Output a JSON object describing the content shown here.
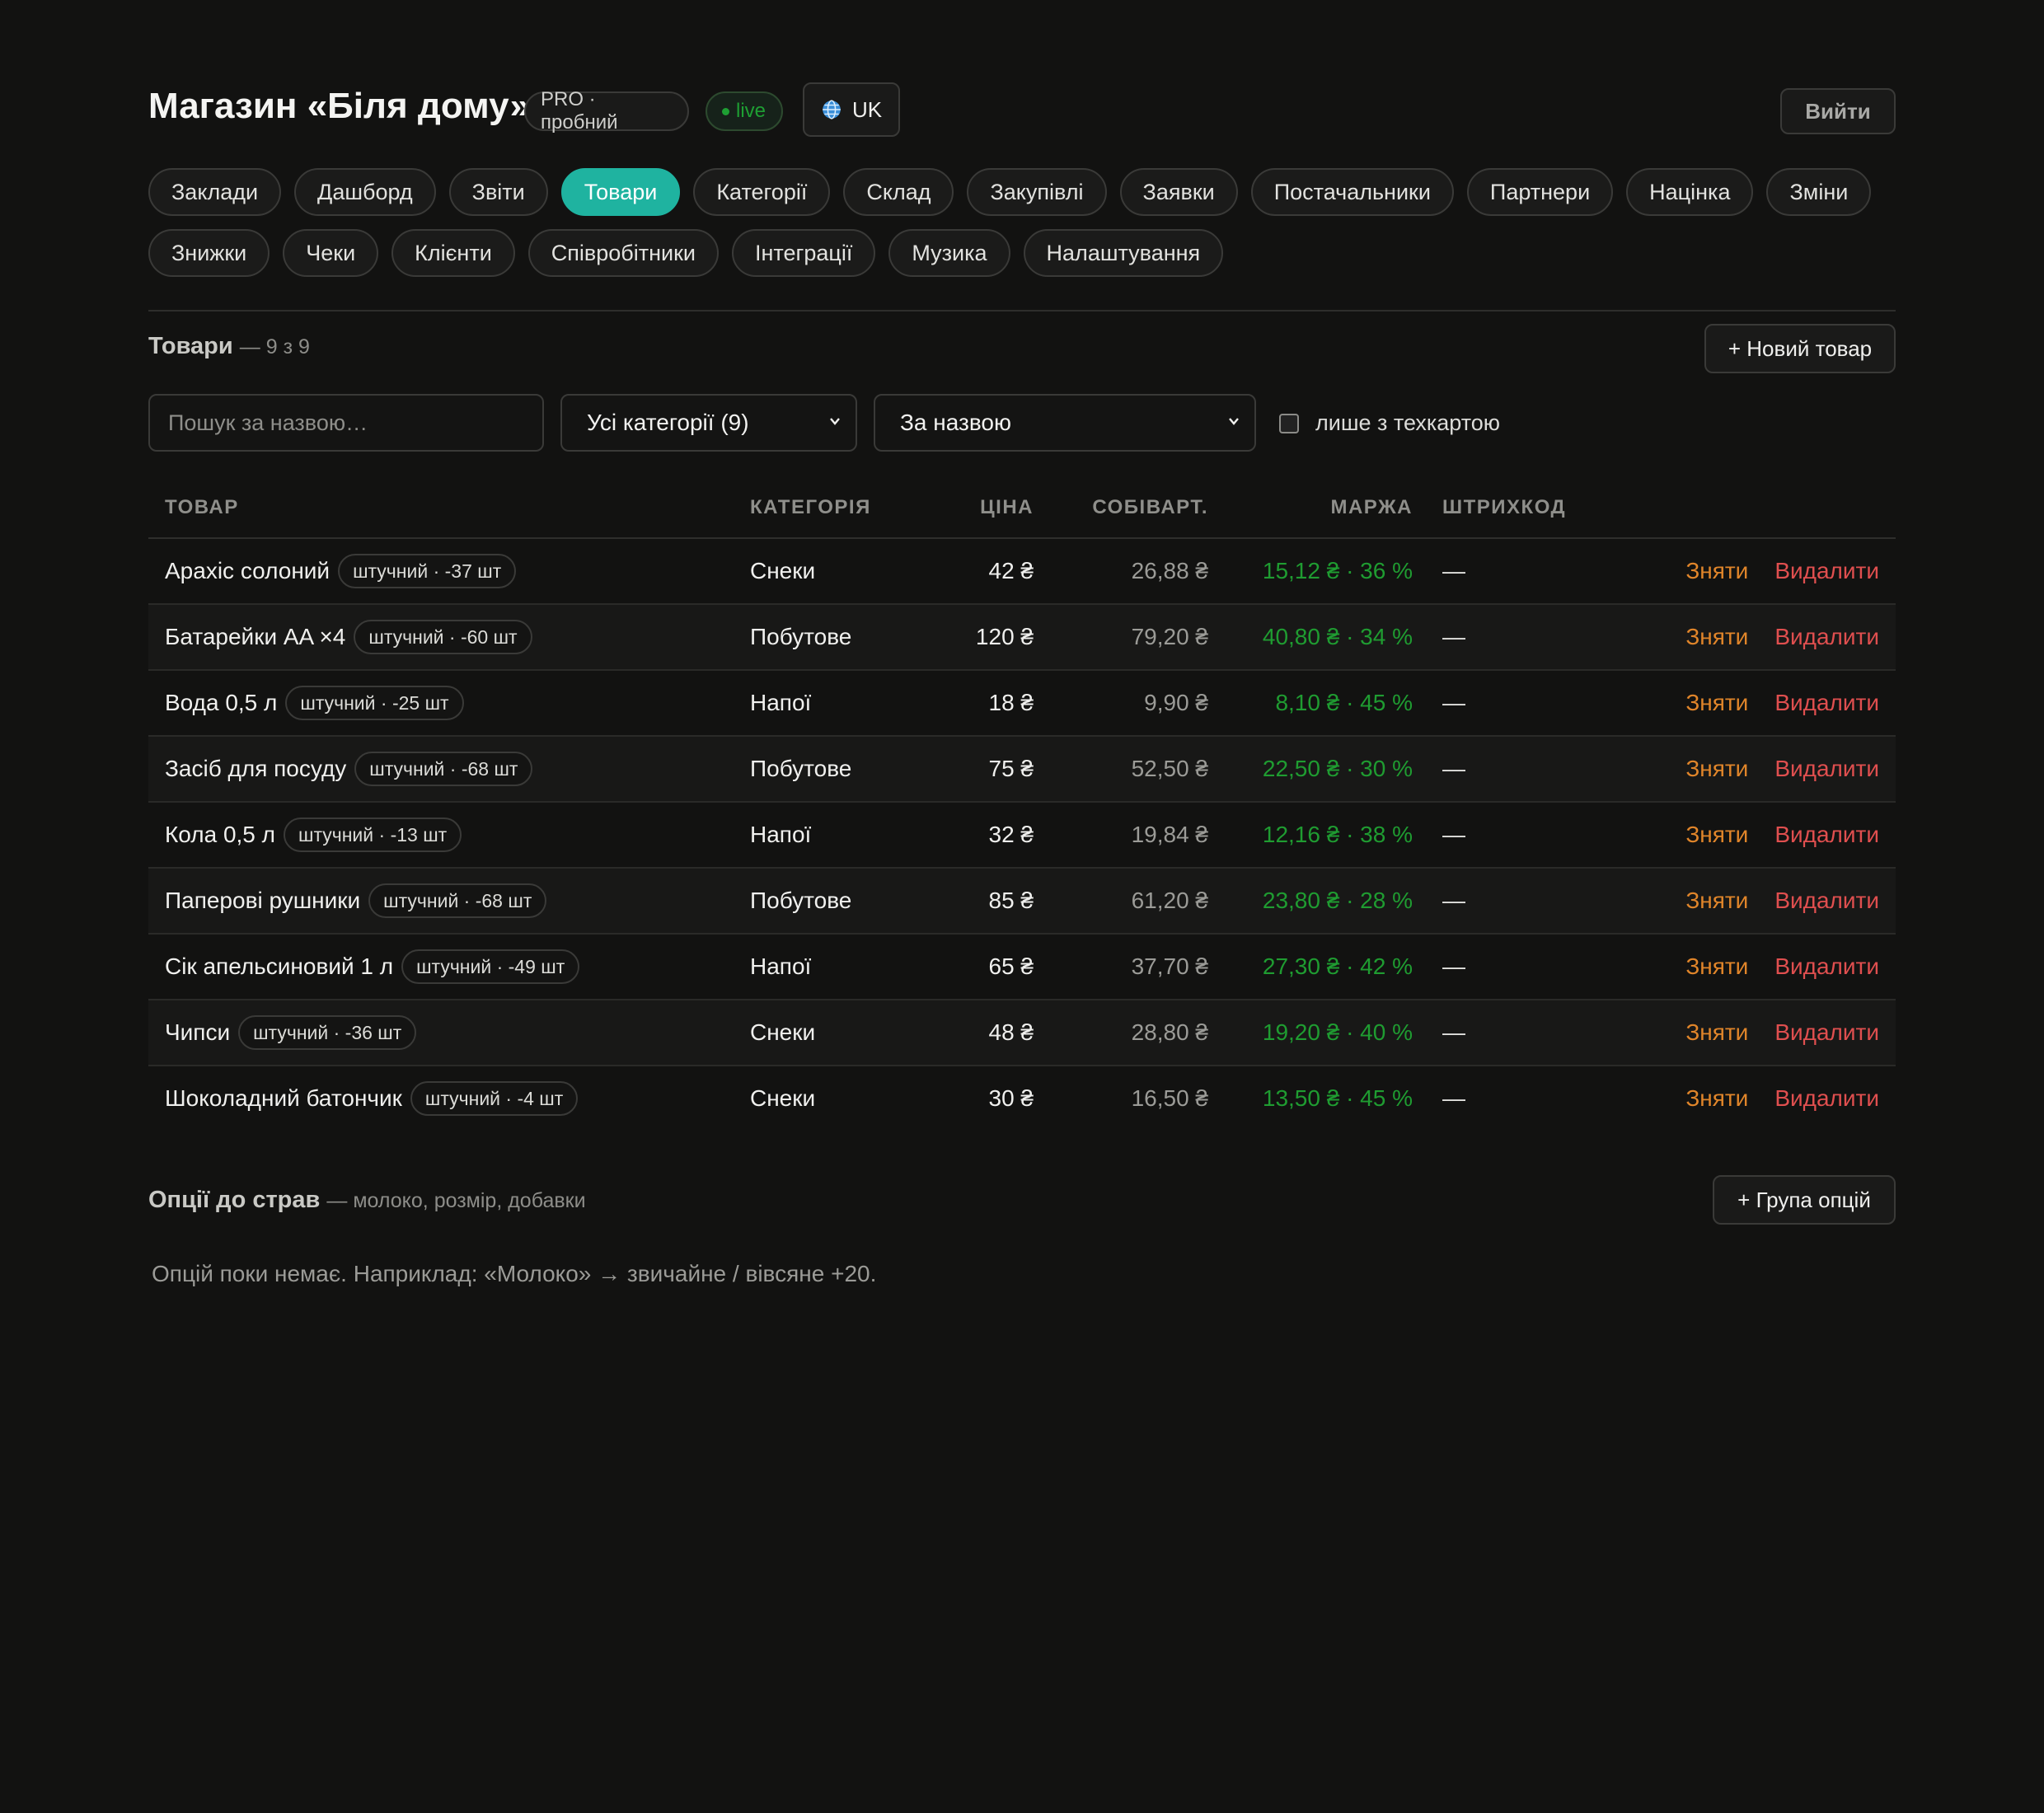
{
  "header": {
    "title": "Магазин «Біля дому»",
    "plan_badge": "PRO · пробний",
    "status_badge": "live",
    "language": "UK",
    "logout_label": "Вийти"
  },
  "nav": {
    "row1": [
      "Заклади",
      "Дашборд",
      "Звіти",
      "Товари",
      "Категорії",
      "Склад",
      "Закупівлі",
      "Заявки",
      "Постачальники",
      "Партнери",
      "Націнка",
      "Зміни"
    ],
    "row2": [
      "Знижки",
      "Чеки",
      "Клієнти",
      "Співробітники",
      "Інтеграції",
      "Музика",
      "Налаштування"
    ],
    "active": "Товари"
  },
  "products": {
    "heading": "Товари",
    "count": "— 9 з 9",
    "new_button": "+ Новий товар",
    "search_placeholder": "Пошук за назвою…",
    "category_filter": "Усі категорії (9)",
    "sort_filter": "За назвою",
    "techcard_only_label": "лише з техкартою",
    "columns": {
      "product": "ТОВАР",
      "category": "КАТЕГОРІЯ",
      "price": "ЦІНА",
      "cost": "СОБІВАРТ.",
      "margin": "МАРЖА",
      "barcode": "ШТРИХКОД"
    },
    "action_off": "Зняти",
    "action_delete": "Видалити",
    "rows": [
      {
        "name": "Арахіс солоний",
        "tag": "штучний · -37 шт",
        "category": "Снеки",
        "price": "42 ₴",
        "cost": "26,88 ₴",
        "margin": "15,12 ₴ · 36 %",
        "barcode": "—"
      },
      {
        "name": "Батарейки AA ×4",
        "tag": "штучний · -60 шт",
        "category": "Побутове",
        "price": "120 ₴",
        "cost": "79,20 ₴",
        "margin": "40,80 ₴ · 34 %",
        "barcode": "—"
      },
      {
        "name": "Вода 0,5 л",
        "tag": "штучний · -25 шт",
        "category": "Напої",
        "price": "18 ₴",
        "cost": "9,90 ₴",
        "margin": "8,10 ₴ · 45 %",
        "barcode": "—"
      },
      {
        "name": "Засіб для посуду",
        "tag": "штучний · -68 шт",
        "category": "Побутове",
        "price": "75 ₴",
        "cost": "52,50 ₴",
        "margin": "22,50 ₴ · 30 %",
        "barcode": "—"
      },
      {
        "name": "Кола 0,5 л",
        "tag": "штучний · -13 шт",
        "category": "Напої",
        "price": "32 ₴",
        "cost": "19,84 ₴",
        "margin": "12,16 ₴ · 38 %",
        "barcode": "—"
      },
      {
        "name": "Паперові рушники",
        "tag": "штучний · -68 шт",
        "category": "Побутове",
        "price": "85 ₴",
        "cost": "61,20 ₴",
        "margin": "23,80 ₴ · 28 %",
        "barcode": "—"
      },
      {
        "name": "Сік апельсиновий 1 л",
        "tag": "штучний · -49 шт",
        "category": "Напої",
        "price": "65 ₴",
        "cost": "37,70 ₴",
        "margin": "27,30 ₴ · 42 %",
        "barcode": "—"
      },
      {
        "name": "Чипси",
        "tag": "штучний · -36 шт",
        "category": "Снеки",
        "price": "48 ₴",
        "cost": "28,80 ₴",
        "margin": "19,20 ₴ · 40 %",
        "barcode": "—"
      },
      {
        "name": "Шоколадний батончик",
        "tag": "штучний · -4 шт",
        "category": "Снеки",
        "price": "30 ₴",
        "cost": "16,50 ₴",
        "margin": "13,50 ₴ · 45 %",
        "barcode": "—"
      }
    ]
  },
  "options": {
    "heading": "Опції до страв",
    "subheading": "— молоко, розмір, добавки",
    "add_button": "+ Група опцій",
    "empty_text": "Опцій поки немає. Наприклад: «Молоко» → звичайне / вівсяне +20."
  },
  "colors": {
    "accent": "#1fb3a0",
    "margin_green": "#1f9c31",
    "action_orange": "#e0852a",
    "action_red": "#e04f4f",
    "background": "#121211"
  }
}
